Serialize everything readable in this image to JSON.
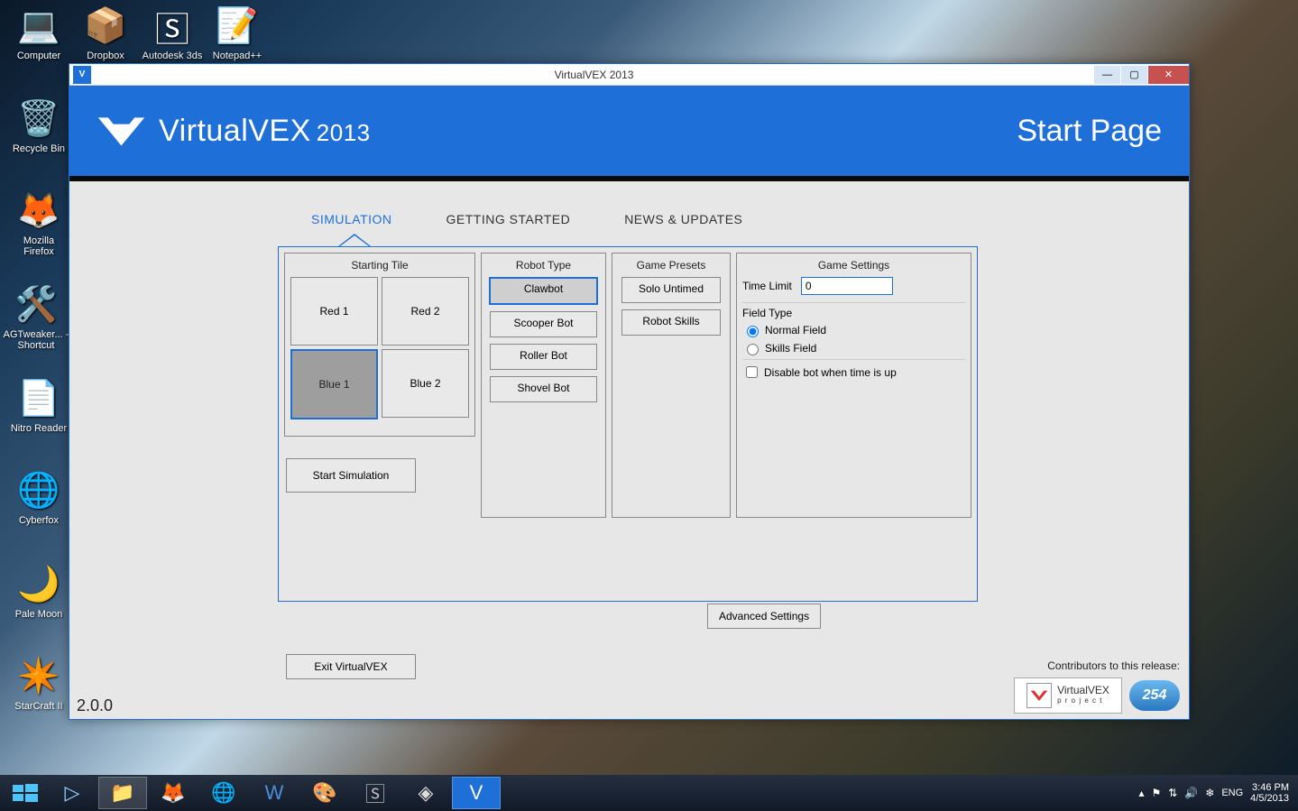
{
  "desktop_icons": [
    {
      "label": "Computer",
      "glyph": "💻"
    },
    {
      "label": "Dropbox",
      "glyph": "📦"
    },
    {
      "label": "Autodesk 3ds",
      "glyph": "🅂"
    },
    {
      "label": "Notepad++",
      "glyph": "📝"
    },
    {
      "label": "Recycle Bin",
      "glyph": "🗑️"
    },
    {
      "label": "Mozilla Firefox",
      "glyph": "🦊"
    },
    {
      "label": "AGTweaker... - Shortcut",
      "glyph": "🛠️"
    },
    {
      "label": "Nitro Reader",
      "glyph": "📄"
    },
    {
      "label": "Cyberfox",
      "glyph": "🌐"
    },
    {
      "label": "Pale Moon",
      "glyph": "🌙"
    },
    {
      "label": "StarCraft II",
      "glyph": "✴️"
    }
  ],
  "window": {
    "title": "VirtualVEX 2013",
    "app_name": "VirtualVEX",
    "app_year": "2013",
    "page_title": "Start Page",
    "version": "2.0.0",
    "tabs": [
      "SIMULATION",
      "GETTING STARTED",
      "NEWS & UPDATES"
    ],
    "starting_tile": {
      "title": "Starting Tile",
      "tiles": [
        "Red 1",
        "Red 2",
        "Blue 1",
        "Blue 2"
      ],
      "selected": "Blue 1",
      "start_btn": "Start Simulation"
    },
    "robot_type": {
      "title": "Robot Type",
      "options": [
        "Clawbot",
        "Scooper Bot",
        "Roller Bot",
        "Shovel Bot"
      ],
      "selected": "Clawbot"
    },
    "game_presets": {
      "title": "Game Presets",
      "options": [
        "Solo Untimed",
        "Robot Skills"
      ]
    },
    "game_settings": {
      "title": "Game Settings",
      "time_limit_label": "Time Limit",
      "time_limit_value": "0",
      "field_type_label": "Field Type",
      "radios": [
        "Normal Field",
        "Skills Field"
      ],
      "radio_selected": "Normal Field",
      "disable_label": "Disable bot when time is up"
    },
    "advanced_btn": "Advanced Settings",
    "exit_btn": "Exit VirtualVEX",
    "contrib_label": "Contributors to this release:",
    "contrib_logo1_text": "VirtualVEX",
    "contrib_logo1_sub": "p r o j e c t",
    "contrib_logo2_text": "254"
  },
  "taskbar": {
    "items": [
      "start",
      "powershell",
      "explorer",
      "firefox",
      "palemoon",
      "word",
      "gimp",
      "autodesk",
      "unity",
      "virtualvex"
    ],
    "lang": "ENG",
    "time": "3:46 PM",
    "date": "4/5/2013"
  }
}
